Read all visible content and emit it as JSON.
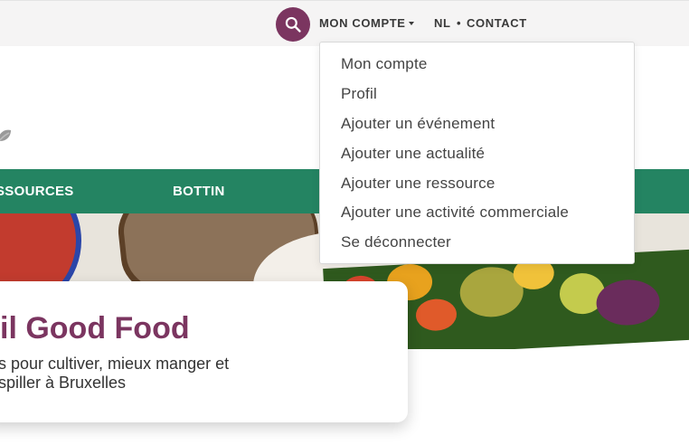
{
  "topbar": {
    "search_icon": "search-icon",
    "account_label": "MON COMPTE",
    "language_label": "NL",
    "separator": "•",
    "contact_label": "CONTACT"
  },
  "account_menu": {
    "items": [
      "Mon compte",
      "Profil",
      "Ajouter un événement",
      "Ajouter une actualité",
      "Ajouter une ressource",
      "Ajouter une activité commerciale",
      "Se déconnecter"
    ]
  },
  "navigation": {
    "items": [
      "SSOURCES",
      "BOTTIN"
    ]
  },
  "hero": {
    "title": "il Good Food",
    "subtitle_line1": "s pour cultiver, mieux manger et",
    "subtitle_line2": "spiller à Bruxelles"
  },
  "colors": {
    "brand_purple": "#7b3560",
    "nav_green": "#248462",
    "topbar_bg": "#f5f4f4"
  }
}
